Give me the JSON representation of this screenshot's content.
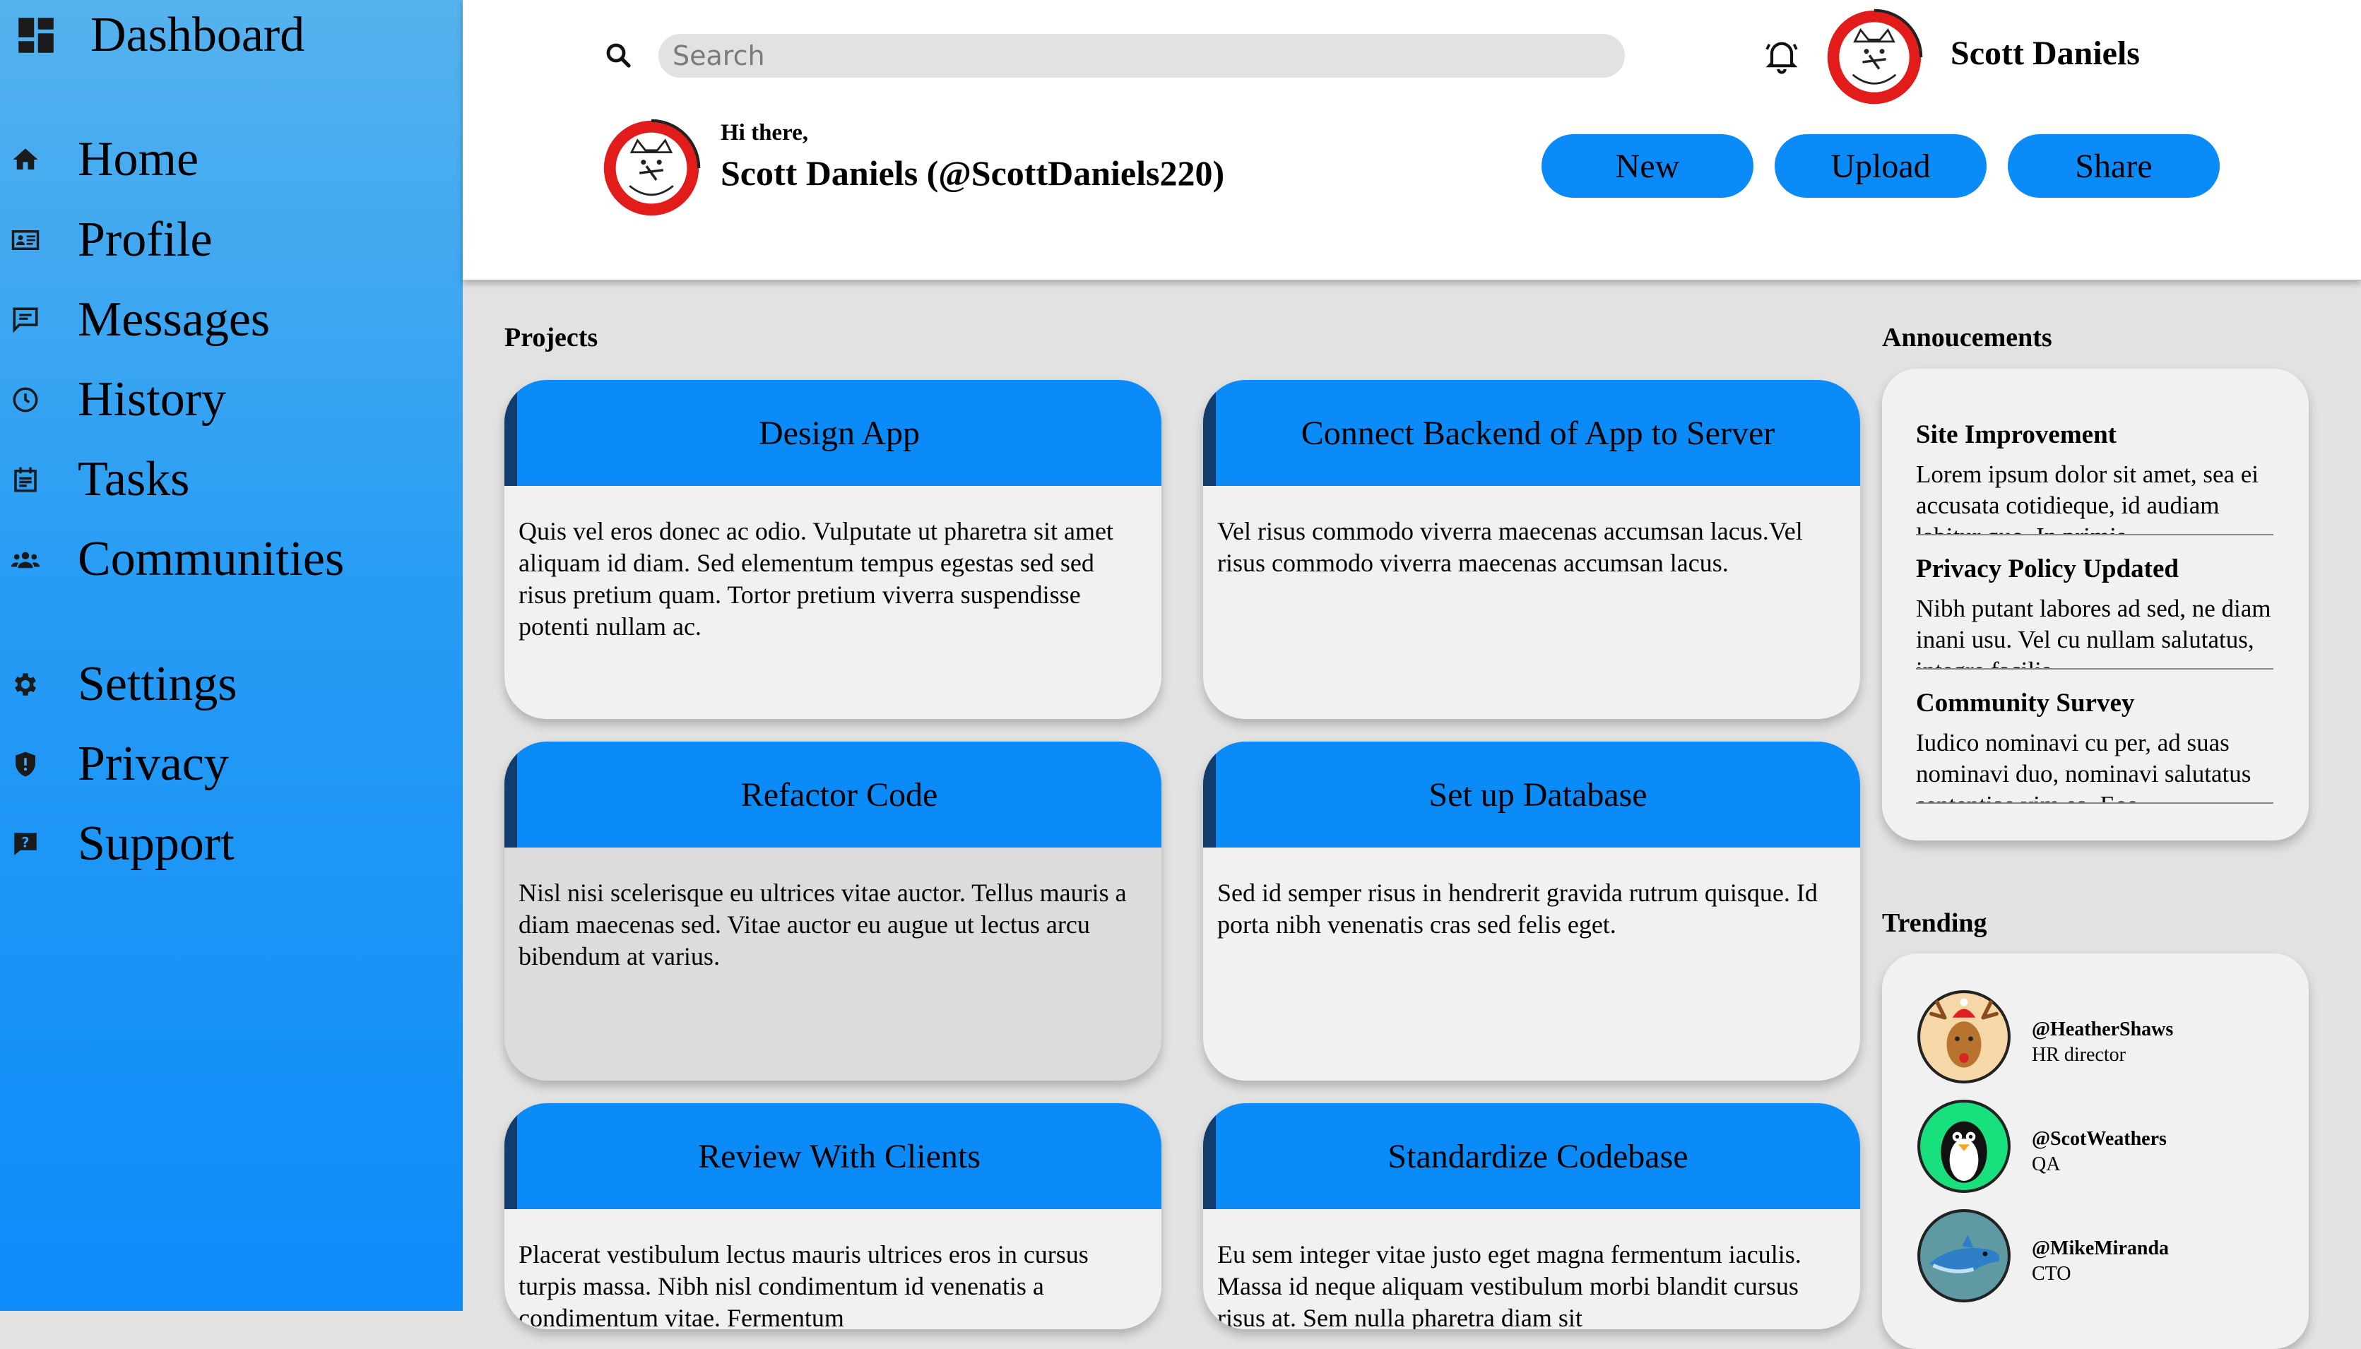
{
  "sidebar": {
    "title": "Dashboard",
    "items": [
      {
        "label": "Home",
        "icon": "home-icon"
      },
      {
        "label": "Profile",
        "icon": "id-card-icon"
      },
      {
        "label": "Messages",
        "icon": "message-icon"
      },
      {
        "label": "History",
        "icon": "clock-icon"
      },
      {
        "label": "Tasks",
        "icon": "tasks-icon"
      },
      {
        "label": "Communities",
        "icon": "people-icon"
      },
      {
        "label": "Settings",
        "icon": "gear-icon"
      },
      {
        "label": "Privacy",
        "icon": "shield-icon"
      },
      {
        "label": "Support",
        "icon": "help-icon"
      }
    ]
  },
  "header": {
    "search_placeholder": "Search",
    "user_name": "Scott Daniels",
    "greeting": "Hi there,",
    "greeting_name": "Scott Daniels (@ScottDaniels220)",
    "buttons": {
      "new": "New",
      "upload": "Upload",
      "share": "Share"
    }
  },
  "projects": {
    "title": "Projects",
    "cards": [
      {
        "title": "Design App",
        "body": "Quis vel eros donec ac odio. Vulputate ut pharetra sit amet aliquam id diam. Sed elementum tempus egestas sed sed risus pretium quam. Tortor pretium viverra suspendisse potenti nullam ac."
      },
      {
        "title": "Connect Backend of App to Server",
        "body": "Vel risus commodo viverra maecenas accumsan lacus.Vel risus commodo viverra maecenas accumsan lacus."
      },
      {
        "title": "Refactor Code",
        "body": "Nisl nisi scelerisque eu ultrices vitae auctor. Tellus mauris a diam maecenas sed. Vitae auctor eu augue ut lectus arcu bibendum at varius."
      },
      {
        "title": "Set up Database",
        "body": "Sed id semper risus in hendrerit gravida rutrum quisque. Id porta nibh venenatis cras sed felis eget."
      },
      {
        "title": "Review With Clients",
        "body": "Placerat vestibulum lectus mauris ultrices eros in cursus turpis massa. Nibh nisl condimentum id venenatis a condimentum vitae. Fermentum"
      },
      {
        "title": "Standardize Codebase",
        "body": "Eu sem integer vitae justo eget magna fermentum iaculis. Massa id neque aliquam vestibulum morbi blandit cursus risus at. Sem nulla pharetra diam sit"
      }
    ]
  },
  "announcements": {
    "title": "Annoucements",
    "items": [
      {
        "title": "Site Improvement",
        "text": "Lorem ipsum dolor sit amet, sea ei accusata cotidieque, id audiam labitur quo. In primis"
      },
      {
        "title": "Privacy Policy Updated",
        "text": "Nibh putant labores ad sed, ne diam inani usu. Vel cu nullam salutatus, integre facilis"
      },
      {
        "title": "Community Survey",
        "text": "Iudico nominavi cu per, ad suas nominavi duo, nominavi salutatus sententiae vim ea. Eos"
      }
    ]
  },
  "trending": {
    "title": "Trending",
    "people": [
      {
        "handle": "@HeatherShaws",
        "role": "HR director",
        "avatar": "reindeer-avatar"
      },
      {
        "handle": "@ScotWeathers",
        "role": "QA",
        "avatar": "penguin-avatar"
      },
      {
        "handle": "@MikeMiranda",
        "role": "CTO",
        "avatar": "dolphin-avatar"
      }
    ]
  },
  "colors": {
    "accent": "#0a8bf8",
    "card_stripe": "#103c70",
    "sidebar_top": "#55b2ee",
    "sidebar_bottom": "#0d8bf9"
  }
}
